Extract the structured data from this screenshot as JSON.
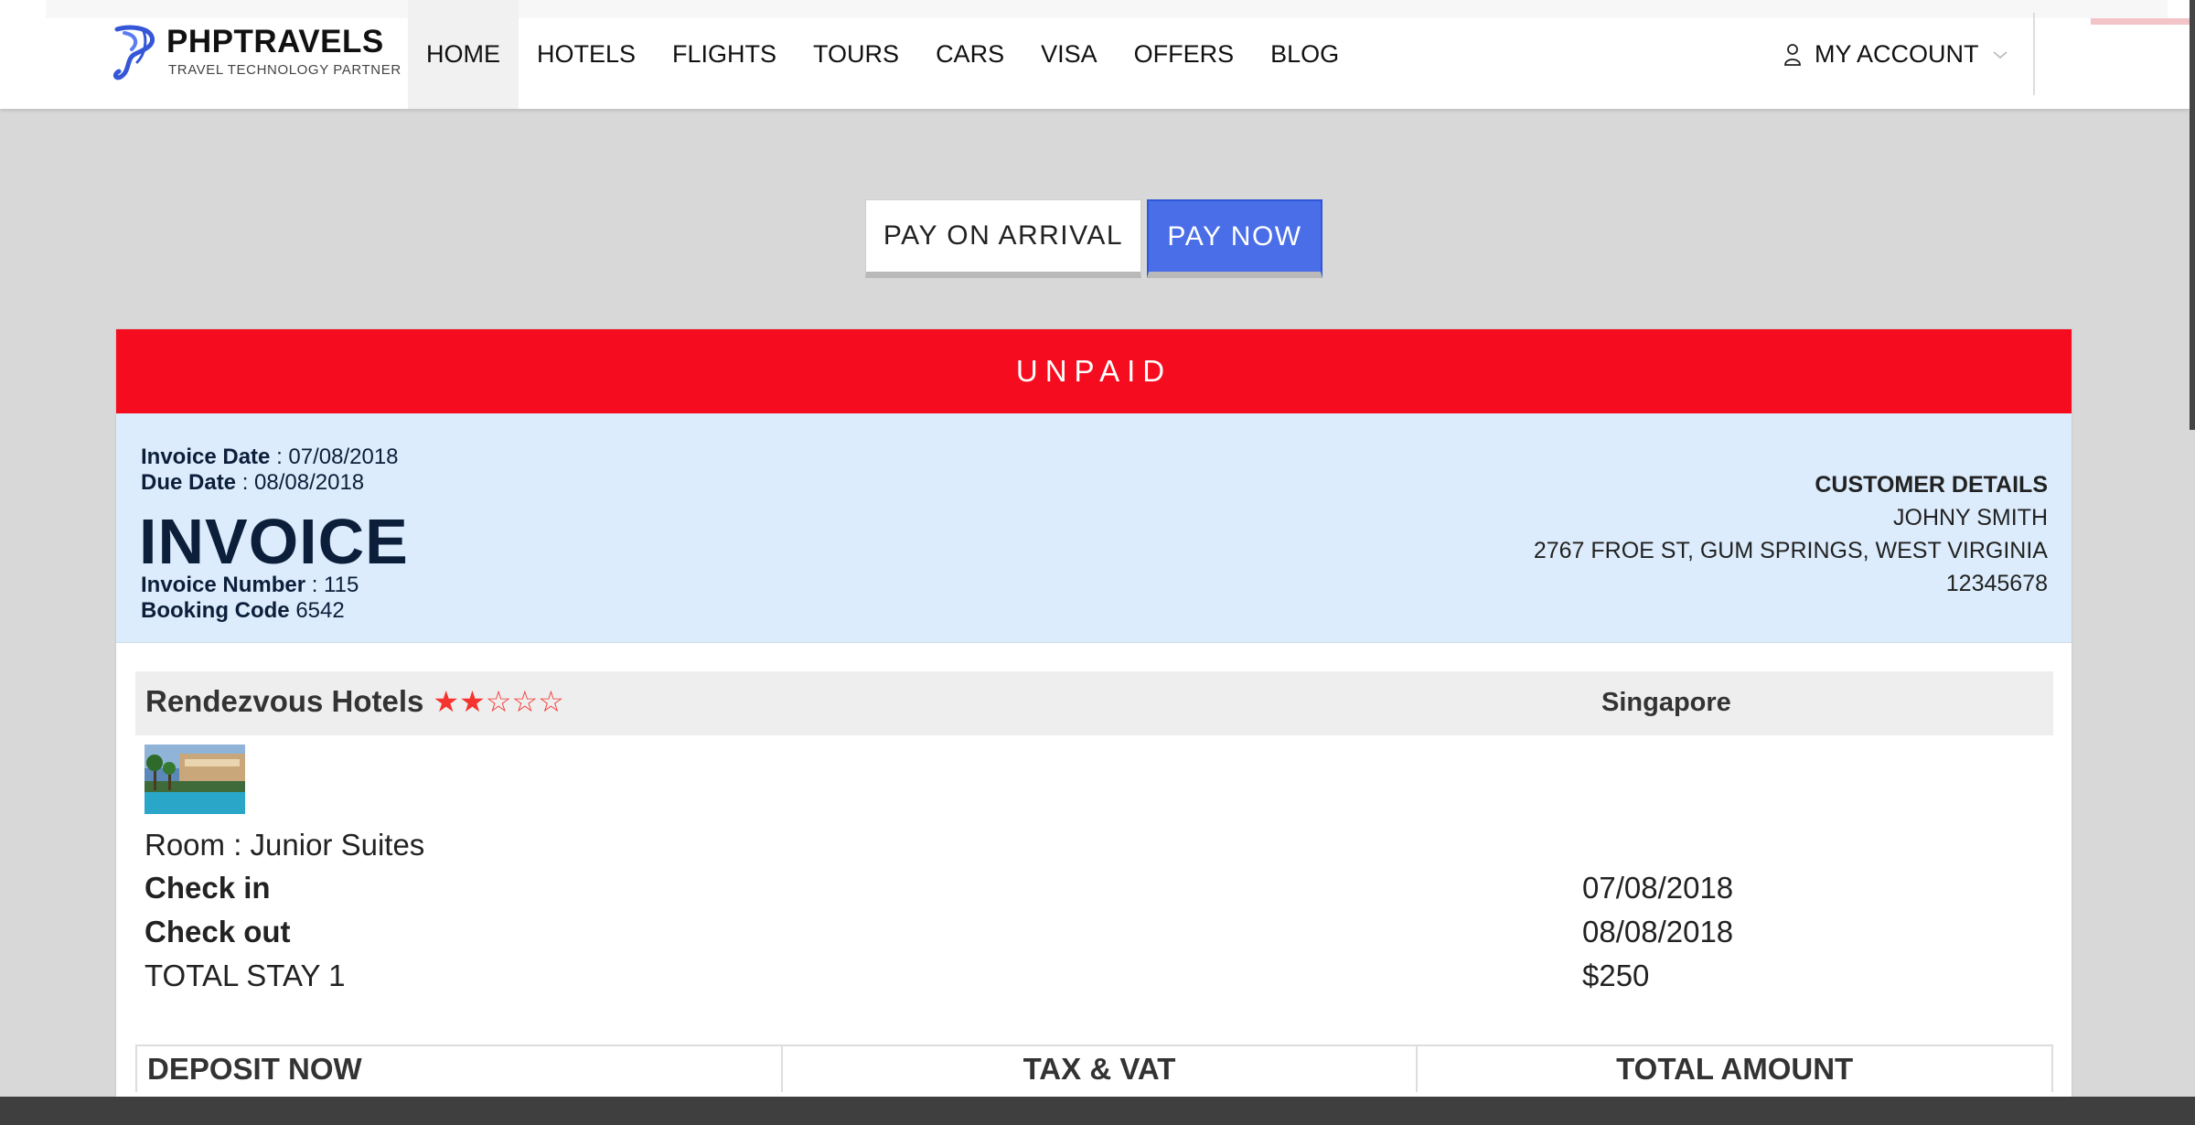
{
  "header": {
    "brand": "PHPTRAVELS",
    "tagline": "TRAVEL TECHNOLOGY PARTNER",
    "nav": [
      "HOME",
      "HOTELS",
      "FLIGHTS",
      "TOURS",
      "CARS",
      "VISA",
      "OFFERS",
      "BLOG"
    ],
    "active_nav": "HOME",
    "account_label": "MY ACCOUNT"
  },
  "payment": {
    "pay_on_arrival": "PAY ON ARRIVAL",
    "pay_now": "PAY NOW"
  },
  "invoice": {
    "status": "UNPAID",
    "invoice_date_label": "Invoice Date",
    "invoice_date": ": 07/08/2018",
    "due_date_label": "Due Date",
    "due_date": ": 08/08/2018",
    "title": "INVOICE",
    "invoice_number_label": "Invoice Number",
    "invoice_number": ": 115",
    "booking_code_label": "Booking Code",
    "booking_code": "6542"
  },
  "customer": {
    "title": "CUSTOMER DETAILS",
    "name": "JOHNY SMITH",
    "address": "2767 FROE ST, GUM SPRINGS, WEST VIRGINIA",
    "phone": "12345678"
  },
  "hotel": {
    "name": "Rendezvous Hotels",
    "stars_filled": 2,
    "stars_total": 5,
    "stars_text": "★★☆☆☆",
    "city": "Singapore",
    "room": "Room : Junior Suites",
    "check_in_label": "Check in",
    "check_in": "07/08/2018",
    "check_out_label": "Check out",
    "check_out": "08/08/2018",
    "total_stay_label": "TOTAL STAY 1",
    "total_stay_price": "$250"
  },
  "totals": {
    "headers": [
      "DEPOSIT NOW",
      "TAX & VAT",
      "TOTAL AMOUNT"
    ]
  },
  "colors": {
    "status_red": "#f50c1e",
    "pay_now_blue": "#4a6ee8",
    "invoice_header_bg": "#dcecfc",
    "star_red": "#f5332f",
    "logo_blue": "#3556d6"
  }
}
